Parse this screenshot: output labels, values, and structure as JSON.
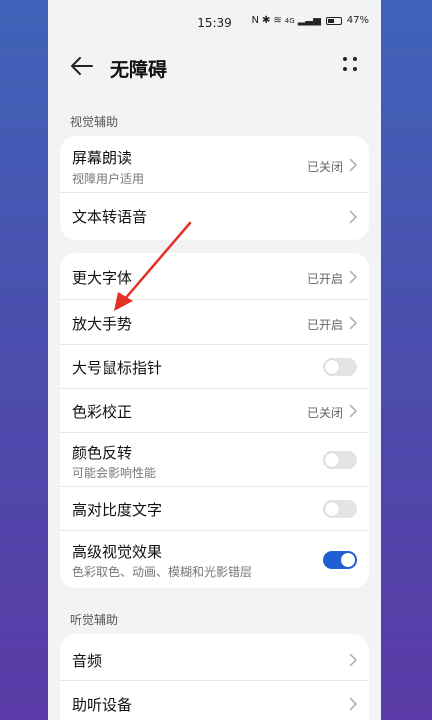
{
  "status_bar": {
    "time": "15:39",
    "battery": "47%",
    "signal_text": "4G"
  },
  "header": {
    "title": "无障碍"
  },
  "sections": {
    "visual": "视觉辅助",
    "hearing": "听觉辅助"
  },
  "card1": [
    {
      "label": "屏幕朗读",
      "sub": "视障用户适用",
      "value": "已关闭"
    },
    {
      "label": "文本转语音"
    }
  ],
  "card2": [
    {
      "label": "更大字体",
      "value": "已开启"
    },
    {
      "label": "放大手势",
      "value": "已开启"
    },
    {
      "label": "大号鼠标指针",
      "toggle": false
    },
    {
      "label": "色彩校正",
      "value": "已关闭"
    },
    {
      "label": "颜色反转",
      "sub": "可能会影响性能",
      "toggle": false
    },
    {
      "label": "高对比度文字",
      "toggle": false
    },
    {
      "label": "高级视觉效果",
      "sub": "色彩取色、动画、模糊和光影错层",
      "toggle": true
    }
  ],
  "card3": [
    {
      "label": "音频"
    },
    {
      "label": "助听设备"
    }
  ],
  "colors": {
    "accent": "#1f5fd1",
    "annotation": "#e53125"
  }
}
